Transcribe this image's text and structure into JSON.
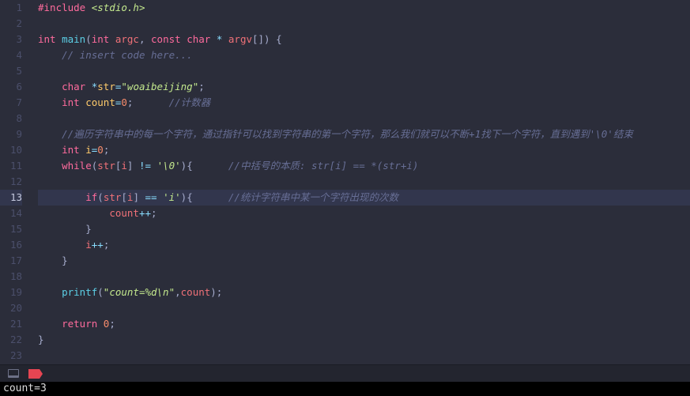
{
  "lines": [
    {
      "num": "1",
      "hl": false
    },
    {
      "num": "2",
      "hl": false
    },
    {
      "num": "3",
      "hl": false
    },
    {
      "num": "4",
      "hl": false
    },
    {
      "num": "5",
      "hl": false
    },
    {
      "num": "6",
      "hl": false
    },
    {
      "num": "7",
      "hl": false
    },
    {
      "num": "8",
      "hl": false
    },
    {
      "num": "9",
      "hl": false
    },
    {
      "num": "10",
      "hl": false
    },
    {
      "num": "11",
      "hl": false
    },
    {
      "num": "12",
      "hl": false
    },
    {
      "num": "13",
      "hl": true
    },
    {
      "num": "14",
      "hl": false
    },
    {
      "num": "15",
      "hl": false
    },
    {
      "num": "16",
      "hl": false
    },
    {
      "num": "17",
      "hl": false
    },
    {
      "num": "18",
      "hl": false
    },
    {
      "num": "19",
      "hl": false
    },
    {
      "num": "20",
      "hl": false
    },
    {
      "num": "21",
      "hl": false
    },
    {
      "num": "22",
      "hl": false
    },
    {
      "num": "23",
      "hl": false
    }
  ],
  "code": {
    "l1": {
      "pp": "#include ",
      "inc": "<stdio.h>"
    },
    "l2": "",
    "l3": {
      "a": "int ",
      "b": "main",
      "c": "(",
      "d": "int ",
      "e": "argc",
      "f": ", ",
      "g": "const ",
      "h": "char ",
      "i": "* ",
      "j": "argv",
      "k": "[]) {"
    },
    "l4": {
      "indent": "    ",
      "cmt": "// insert code here..."
    },
    "l5": "",
    "l6": {
      "indent": "    ",
      "a": "char ",
      "b": "*",
      "c": "str",
      "d": "=",
      "e": "\"woaibeijing\"",
      "f": ";"
    },
    "l7": {
      "indent": "    ",
      "a": "int ",
      "b": "count",
      "c": "=",
      "d": "0",
      "e": ";",
      "pad": "      ",
      "cmt": "//计数器"
    },
    "l8": "",
    "l9": {
      "indent": "    ",
      "cmt": "//遍历字符串中的每一个字符，通过指针可以找到字符串的第一个字符，那么我们就可以不断+1找下一个字符，直到遇到'\\0'结束"
    },
    "l10": {
      "indent": "    ",
      "a": "int ",
      "b": "i",
      "c": "=",
      "d": "0",
      "e": ";"
    },
    "l11": {
      "indent": "    ",
      "a": "while",
      "b": "(",
      "c": "str",
      "d": "[",
      "e": "i",
      "f": "] ",
      "g": "!= ",
      "h": "'\\0'",
      "i": "){",
      "pad": "      ",
      "cmt": "//中括号的本质: str[i] == *(str+i)"
    },
    "l12": "",
    "l13": {
      "indent": "        ",
      "a": "if",
      "b": "(",
      "c": "str",
      "d": "[",
      "e": "i",
      "f": "] ",
      "g": "== ",
      "h": "'i'",
      "i": "){",
      "pad": "      ",
      "cmt": "//统计字符串中某一个字符出现的次数"
    },
    "l14": {
      "indent": "            ",
      "a": "count",
      "b": "++",
      "c": ";"
    },
    "l15": {
      "indent": "        ",
      "a": "}"
    },
    "l16": {
      "indent": "        ",
      "a": "i",
      "b": "++",
      "c": ";"
    },
    "l17": {
      "indent": "    ",
      "a": "}"
    },
    "l18": "",
    "l19": {
      "indent": "    ",
      "a": "printf",
      "b": "(",
      "c": "\"count=%d\\n\"",
      "d": ",",
      "e": "count",
      "f": ");"
    },
    "l20": "",
    "l21": {
      "indent": "    ",
      "a": "return ",
      "b": "0",
      "c": ";"
    },
    "l22": {
      "a": "}"
    },
    "l23": ""
  },
  "console": {
    "output": "count=3"
  }
}
